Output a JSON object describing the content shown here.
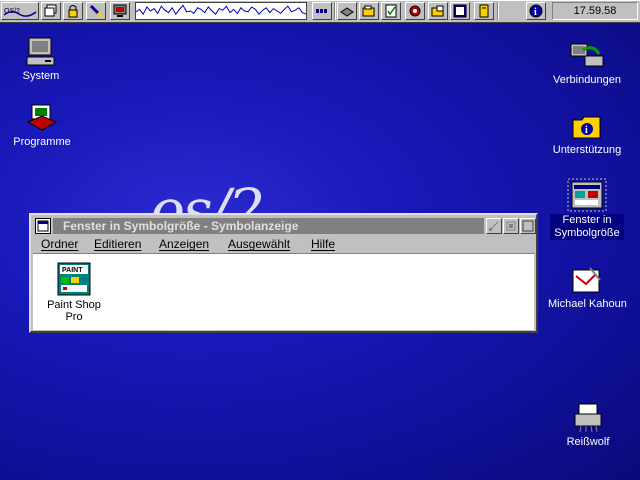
{
  "taskbar": {
    "logo_text": "OS/2",
    "clock": "17.59.58",
    "cpu_load": [
      0.45,
      0.6,
      0.3,
      0.75,
      0.5,
      0.65,
      0.35,
      0.8,
      0.55,
      0.4,
      0.7,
      0.3,
      0.6,
      0.85,
      0.45,
      0.5,
      0.35,
      0.7,
      0.6,
      0.4,
      0.75,
      0.5,
      0.3,
      0.65,
      0.55,
      0.8,
      0.4,
      0.6,
      0.35,
      0.7,
      0.5,
      0.45,
      0.75,
      0.6,
      0.3,
      0.55,
      0.7,
      0.4,
      0.65,
      0.5,
      0.35,
      0.6,
      0.8,
      0.45,
      0.55,
      0.7,
      0.4,
      0.3
    ]
  },
  "desktop": {
    "left_icons": [
      {
        "label": "System"
      },
      {
        "label": "Programme"
      }
    ],
    "right_icons": [
      {
        "label": "Verbindungen"
      },
      {
        "label": "Unterstützung"
      },
      {
        "label_line1": "Fenster in",
        "label_line2": "Symbolgröße"
      },
      {
        "label": "Michael Kahoun"
      },
      {
        "label": "Reißwolf"
      }
    ]
  },
  "window": {
    "title": "Fenster in Symbolgröße - Symbolanzeige",
    "menu": [
      "Ordner",
      "Editieren",
      "Anzeigen",
      "Ausgewählt",
      "Hilfe"
    ],
    "items": [
      {
        "label": "Paint Shop Pro",
        "badge": "PAINT"
      }
    ]
  }
}
